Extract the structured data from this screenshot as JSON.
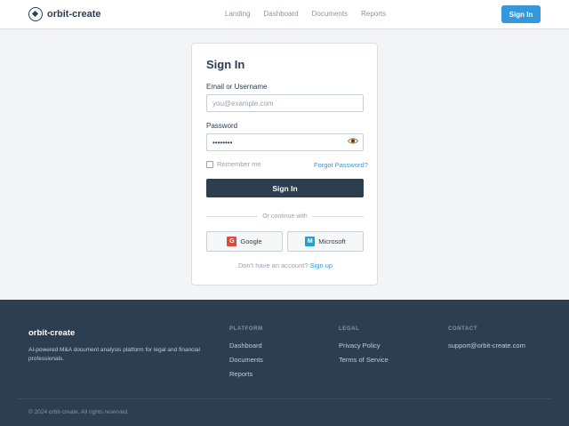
{
  "header": {
    "brand": "orbit-create",
    "nav": [
      "Landing",
      "Dashboard",
      "Documents",
      "Reports"
    ],
    "sign_in_label": "Sign In"
  },
  "signin": {
    "title": "Sign In",
    "email_label": "Email or Username",
    "email_placeholder": "you@example.com",
    "password_label": "Password",
    "password_value": "password",
    "remember_label": "Remember me",
    "forgot_label": "Forgot Password?",
    "submit_label": "Sign In",
    "divider_text": "Or continue with",
    "google": {
      "letter": "G",
      "label": "Google",
      "color": "#dd4b39"
    },
    "microsoft": {
      "letter": "M",
      "label": "Microsoft",
      "color": "#1aa3dc"
    },
    "no_account_text": "Don't have an account?",
    "signup_label": "Sign up"
  },
  "footer": {
    "brand": "orbit-create",
    "description": "AI-powered M&A document analysis platform for legal and financial professionals.",
    "platform": {
      "heading": "PLATFORM",
      "links": [
        "Dashboard",
        "Documents",
        "Reports"
      ]
    },
    "legal": {
      "heading": "LEGAL",
      "links": [
        "Privacy Policy",
        "Terms of Service"
      ]
    },
    "contact": {
      "heading": "CONTACT",
      "email": "support@orbit-create.com"
    },
    "copyright": "© 2024 orbit-create. All rights reserved."
  },
  "colors": {
    "primary": "#2c3e50",
    "accent": "#3498db"
  }
}
